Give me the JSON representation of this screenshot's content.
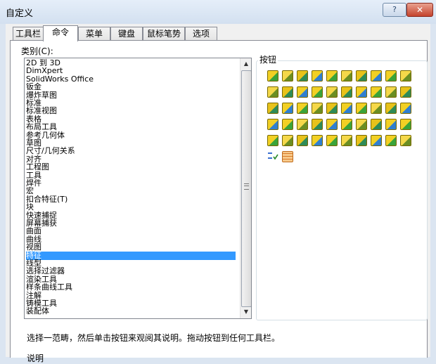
{
  "window": {
    "title": "自定义",
    "help_glyph": "?",
    "close_glyph": "✕"
  },
  "tabs": [
    {
      "label": "工具栏",
      "active": false
    },
    {
      "label": "命令",
      "active": true
    },
    {
      "label": "菜单",
      "active": false
    },
    {
      "label": "键盘",
      "active": false
    },
    {
      "label": "鼠标笔势",
      "active": false
    },
    {
      "label": "选项",
      "active": false
    }
  ],
  "category_label": "类别(C):",
  "categories": [
    "2D 到 3D",
    "DimXpert",
    "SolidWorks Office",
    "钣金",
    "爆炸草图",
    "标准",
    "标准视图",
    "表格",
    "布局工具",
    "参考几何体",
    "草图",
    "尺寸/几何关系",
    "对齐",
    "工程图",
    "工具",
    "焊件",
    "宏",
    "扣合特征(T)",
    "块",
    "快速捕捉",
    "屏幕捕获",
    "曲面",
    "曲线",
    "视图",
    "特征",
    "线型",
    "选择过滤器",
    "渲染工具",
    "样条曲线工具",
    "注解",
    "铸模工具",
    "装配体"
  ],
  "selected_category": "特征",
  "buttons_label": "按钮",
  "icons": [
    "extruded-boss-icon",
    "revolved-boss-icon",
    "swept-boss-icon",
    "lofted-boss-icon",
    "boundary-boss-icon",
    "extruded-cut-icon",
    "hole-wizard-icon",
    "revolved-cut-icon",
    "swept-cut-icon",
    "lofted-cut-icon",
    "boundary-cut-icon",
    "fillet-icon",
    "linear-pattern-icon",
    "rib-icon",
    "draft-icon",
    "shell-icon",
    "wrap-icon",
    "dome-icon",
    "freeform-icon",
    "flex-icon",
    "intersect-icon",
    "deform-icon",
    "indent-icon",
    "thicken-icon",
    "shape-icon",
    "mirror-icon",
    "split-line-icon",
    "circular-pattern-icon",
    "combine-icon",
    "move-face-icon",
    "curve-driven-pattern-icon",
    "sketch-driven-pattern-icon",
    "table-driven-pattern-icon",
    "fill-pattern-icon",
    "variable-pattern-icon",
    "chamfer-icon",
    "scale-icon",
    "delete-body-icon",
    "cosmetic-thread-icon",
    "curve-through-points-icon",
    "surface-pattern-icon",
    "knit-icon",
    "offset-icon",
    "radiate-icon",
    "combine-bodies-icon",
    "split-icon",
    "move-copy-icon",
    "replace-face-icon",
    "intersection-curve-icon",
    "reference-point-icon",
    "equations-icon",
    "3d-grid-icon"
  ],
  "hint_text": "选择一范畴，然后单击按钮来观阅其说明。拖动按钮到任何工具栏。",
  "description_label": "说明",
  "colors": {
    "accent": "#3399ff",
    "icon_yellow": "#f2d024",
    "icon_green": "#3aa33a",
    "titlebar": "#dbe5f1"
  }
}
